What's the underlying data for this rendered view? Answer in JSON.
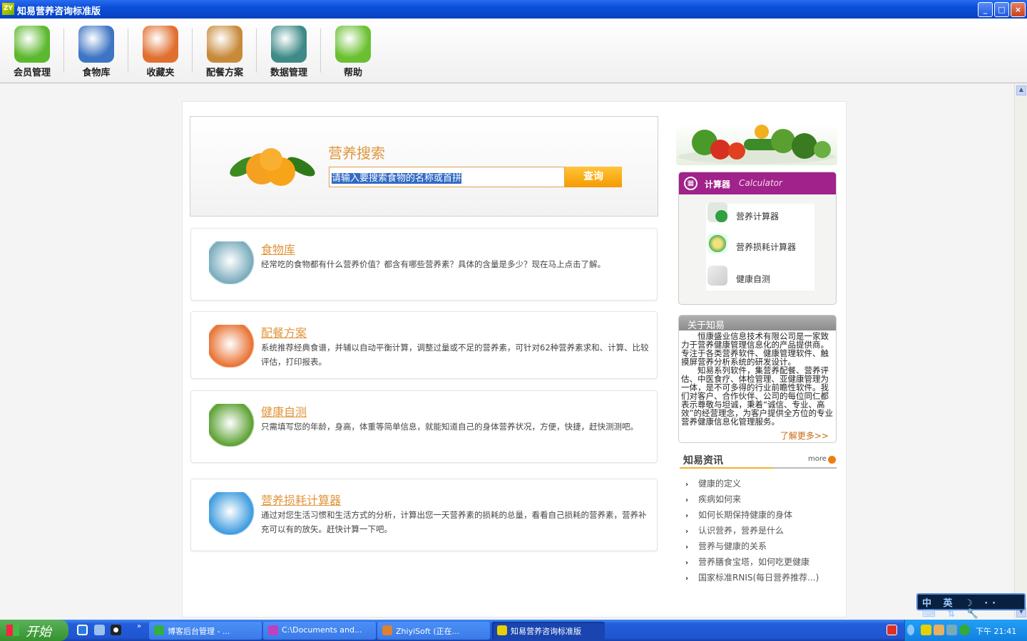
{
  "window": {
    "title": "知易营养咨询标准版",
    "logo_text": "ZY",
    "min": "_",
    "max": "□",
    "close": "×"
  },
  "toolbar": [
    {
      "label": "会员管理",
      "icon": "member-icon",
      "color": "#5cb82e"
    },
    {
      "label": "食物库",
      "icon": "teacup-icon",
      "color": "#3d74c4"
    },
    {
      "label": "收藏夹",
      "icon": "folder-icon",
      "color": "#e07030"
    },
    {
      "label": "配餐方案",
      "icon": "palette-icon",
      "color": "#c88a3a"
    },
    {
      "label": "数据管理",
      "icon": "database-icon",
      "color": "#3d8a88"
    },
    {
      "label": "帮助",
      "icon": "help-icon",
      "color": "#6ac030"
    }
  ],
  "search": {
    "title": "营养搜索",
    "input_value": "请输入要搜索食物的名称或首拼",
    "button": "查询"
  },
  "cards": [
    {
      "title": "食物库",
      "desc": "经常吃的食物都有什么营养价值？都含有哪些营养素？具体的含量是多少？现在马上点击了解。",
      "icon": "food-library-icon"
    },
    {
      "title": "配餐方案",
      "desc": "系统推荐经典食谱，并辅以自动平衡计算，调整过量或不足的营养素，可针对62种营养素求和、计算、比较评估，打印报表。",
      "icon": "meal-plan-icon"
    },
    {
      "title": "健康自测",
      "desc": "只需填写您的年龄，身高，体重等简单信息，就能知道自己的身体营养状况，方便，快捷，赶快测测吧。",
      "icon": "health-test-icon"
    },
    {
      "title": "营养损耗计算器",
      "desc": "通过对您生活习惯和生活方式的分析，计算出您一天营养素的损耗的总量，看看自己损耗的营养素，营养补充可以有的放矢。赶快计算一下吧。",
      "icon": "nutrient-loss-icon"
    }
  ],
  "calculator": {
    "title": "计算器",
    "subtitle": "Calculator",
    "items": [
      "营养计算器",
      "营养损耗计算器",
      "健康自测"
    ]
  },
  "about": {
    "title": "关于知易",
    "text": "　　恒康盛业信息技术有限公司是一家致力于营养健康管理信息化的产品提供商。专注于各类营养软件、健康管理软件、触摸屏营养分析系统的研发设计。\n　　知易系列软件，集营养配餐、营养评估、中医食疗、体检管理、亚健康管理为一体，是不可多得的行业前瞻性软件。我们对客户、合作伙伴、公司的每位同仁都表示尊敬与坦诚，秉着“诚信、专业、高效”的经营理念，为客户提供全方位的专业营养健康信息化管理服务。",
    "more": "了解更多>>"
  },
  "news": {
    "title": "知易资讯",
    "more": "more",
    "items": [
      "健康的定义",
      "疾病如何来",
      "如何长期保持健康的身体",
      "认识营养，营养是什么",
      "营养与健康的关系",
      "营养膳食宝塔，如何吃更健康",
      "国家标准RNIS(每日营养推荐...)"
    ]
  },
  "ime": {
    "text": "中 英 ☽ ·· ⌨ ⇅ 🔧"
  },
  "taskbar": {
    "start": "开始",
    "tasks": [
      "博客后台管理 - ...",
      "C:\\Documents and...",
      "ZhiyiSoft (正在...",
      "知易营养咨询标准版"
    ],
    "active_task": 3,
    "clock": "下午 21:41"
  }
}
